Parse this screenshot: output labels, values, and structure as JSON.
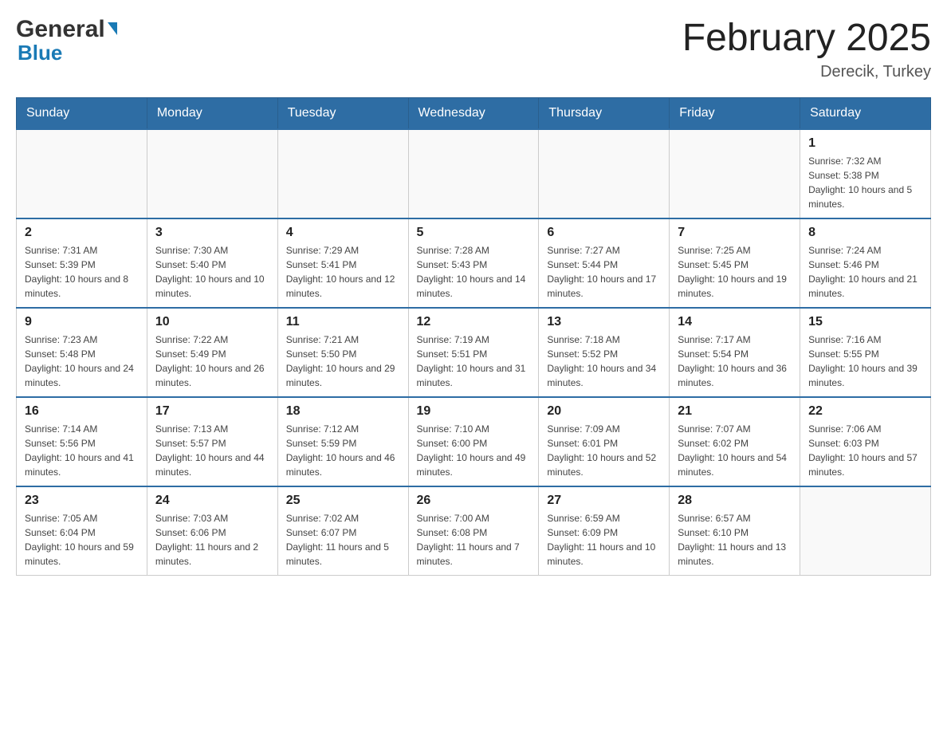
{
  "header": {
    "logo_general": "General",
    "logo_blue": "Blue",
    "main_title": "February 2025",
    "subtitle": "Derecik, Turkey"
  },
  "days_of_week": [
    "Sunday",
    "Monday",
    "Tuesday",
    "Wednesday",
    "Thursday",
    "Friday",
    "Saturday"
  ],
  "weeks": [
    {
      "days": [
        {
          "date": "",
          "info": ""
        },
        {
          "date": "",
          "info": ""
        },
        {
          "date": "",
          "info": ""
        },
        {
          "date": "",
          "info": ""
        },
        {
          "date": "",
          "info": ""
        },
        {
          "date": "",
          "info": ""
        },
        {
          "date": "1",
          "info": "Sunrise: 7:32 AM\nSunset: 5:38 PM\nDaylight: 10 hours and 5 minutes."
        }
      ]
    },
    {
      "days": [
        {
          "date": "2",
          "info": "Sunrise: 7:31 AM\nSunset: 5:39 PM\nDaylight: 10 hours and 8 minutes."
        },
        {
          "date": "3",
          "info": "Sunrise: 7:30 AM\nSunset: 5:40 PM\nDaylight: 10 hours and 10 minutes."
        },
        {
          "date": "4",
          "info": "Sunrise: 7:29 AM\nSunset: 5:41 PM\nDaylight: 10 hours and 12 minutes."
        },
        {
          "date": "5",
          "info": "Sunrise: 7:28 AM\nSunset: 5:43 PM\nDaylight: 10 hours and 14 minutes."
        },
        {
          "date": "6",
          "info": "Sunrise: 7:27 AM\nSunset: 5:44 PM\nDaylight: 10 hours and 17 minutes."
        },
        {
          "date": "7",
          "info": "Sunrise: 7:25 AM\nSunset: 5:45 PM\nDaylight: 10 hours and 19 minutes."
        },
        {
          "date": "8",
          "info": "Sunrise: 7:24 AM\nSunset: 5:46 PM\nDaylight: 10 hours and 21 minutes."
        }
      ]
    },
    {
      "days": [
        {
          "date": "9",
          "info": "Sunrise: 7:23 AM\nSunset: 5:48 PM\nDaylight: 10 hours and 24 minutes."
        },
        {
          "date": "10",
          "info": "Sunrise: 7:22 AM\nSunset: 5:49 PM\nDaylight: 10 hours and 26 minutes."
        },
        {
          "date": "11",
          "info": "Sunrise: 7:21 AM\nSunset: 5:50 PM\nDaylight: 10 hours and 29 minutes."
        },
        {
          "date": "12",
          "info": "Sunrise: 7:19 AM\nSunset: 5:51 PM\nDaylight: 10 hours and 31 minutes."
        },
        {
          "date": "13",
          "info": "Sunrise: 7:18 AM\nSunset: 5:52 PM\nDaylight: 10 hours and 34 minutes."
        },
        {
          "date": "14",
          "info": "Sunrise: 7:17 AM\nSunset: 5:54 PM\nDaylight: 10 hours and 36 minutes."
        },
        {
          "date": "15",
          "info": "Sunrise: 7:16 AM\nSunset: 5:55 PM\nDaylight: 10 hours and 39 minutes."
        }
      ]
    },
    {
      "days": [
        {
          "date": "16",
          "info": "Sunrise: 7:14 AM\nSunset: 5:56 PM\nDaylight: 10 hours and 41 minutes."
        },
        {
          "date": "17",
          "info": "Sunrise: 7:13 AM\nSunset: 5:57 PM\nDaylight: 10 hours and 44 minutes."
        },
        {
          "date": "18",
          "info": "Sunrise: 7:12 AM\nSunset: 5:59 PM\nDaylight: 10 hours and 46 minutes."
        },
        {
          "date": "19",
          "info": "Sunrise: 7:10 AM\nSunset: 6:00 PM\nDaylight: 10 hours and 49 minutes."
        },
        {
          "date": "20",
          "info": "Sunrise: 7:09 AM\nSunset: 6:01 PM\nDaylight: 10 hours and 52 minutes."
        },
        {
          "date": "21",
          "info": "Sunrise: 7:07 AM\nSunset: 6:02 PM\nDaylight: 10 hours and 54 minutes."
        },
        {
          "date": "22",
          "info": "Sunrise: 7:06 AM\nSunset: 6:03 PM\nDaylight: 10 hours and 57 minutes."
        }
      ]
    },
    {
      "days": [
        {
          "date": "23",
          "info": "Sunrise: 7:05 AM\nSunset: 6:04 PM\nDaylight: 10 hours and 59 minutes."
        },
        {
          "date": "24",
          "info": "Sunrise: 7:03 AM\nSunset: 6:06 PM\nDaylight: 11 hours and 2 minutes."
        },
        {
          "date": "25",
          "info": "Sunrise: 7:02 AM\nSunset: 6:07 PM\nDaylight: 11 hours and 5 minutes."
        },
        {
          "date": "26",
          "info": "Sunrise: 7:00 AM\nSunset: 6:08 PM\nDaylight: 11 hours and 7 minutes."
        },
        {
          "date": "27",
          "info": "Sunrise: 6:59 AM\nSunset: 6:09 PM\nDaylight: 11 hours and 10 minutes."
        },
        {
          "date": "28",
          "info": "Sunrise: 6:57 AM\nSunset: 6:10 PM\nDaylight: 11 hours and 13 minutes."
        },
        {
          "date": "",
          "info": ""
        }
      ]
    }
  ]
}
